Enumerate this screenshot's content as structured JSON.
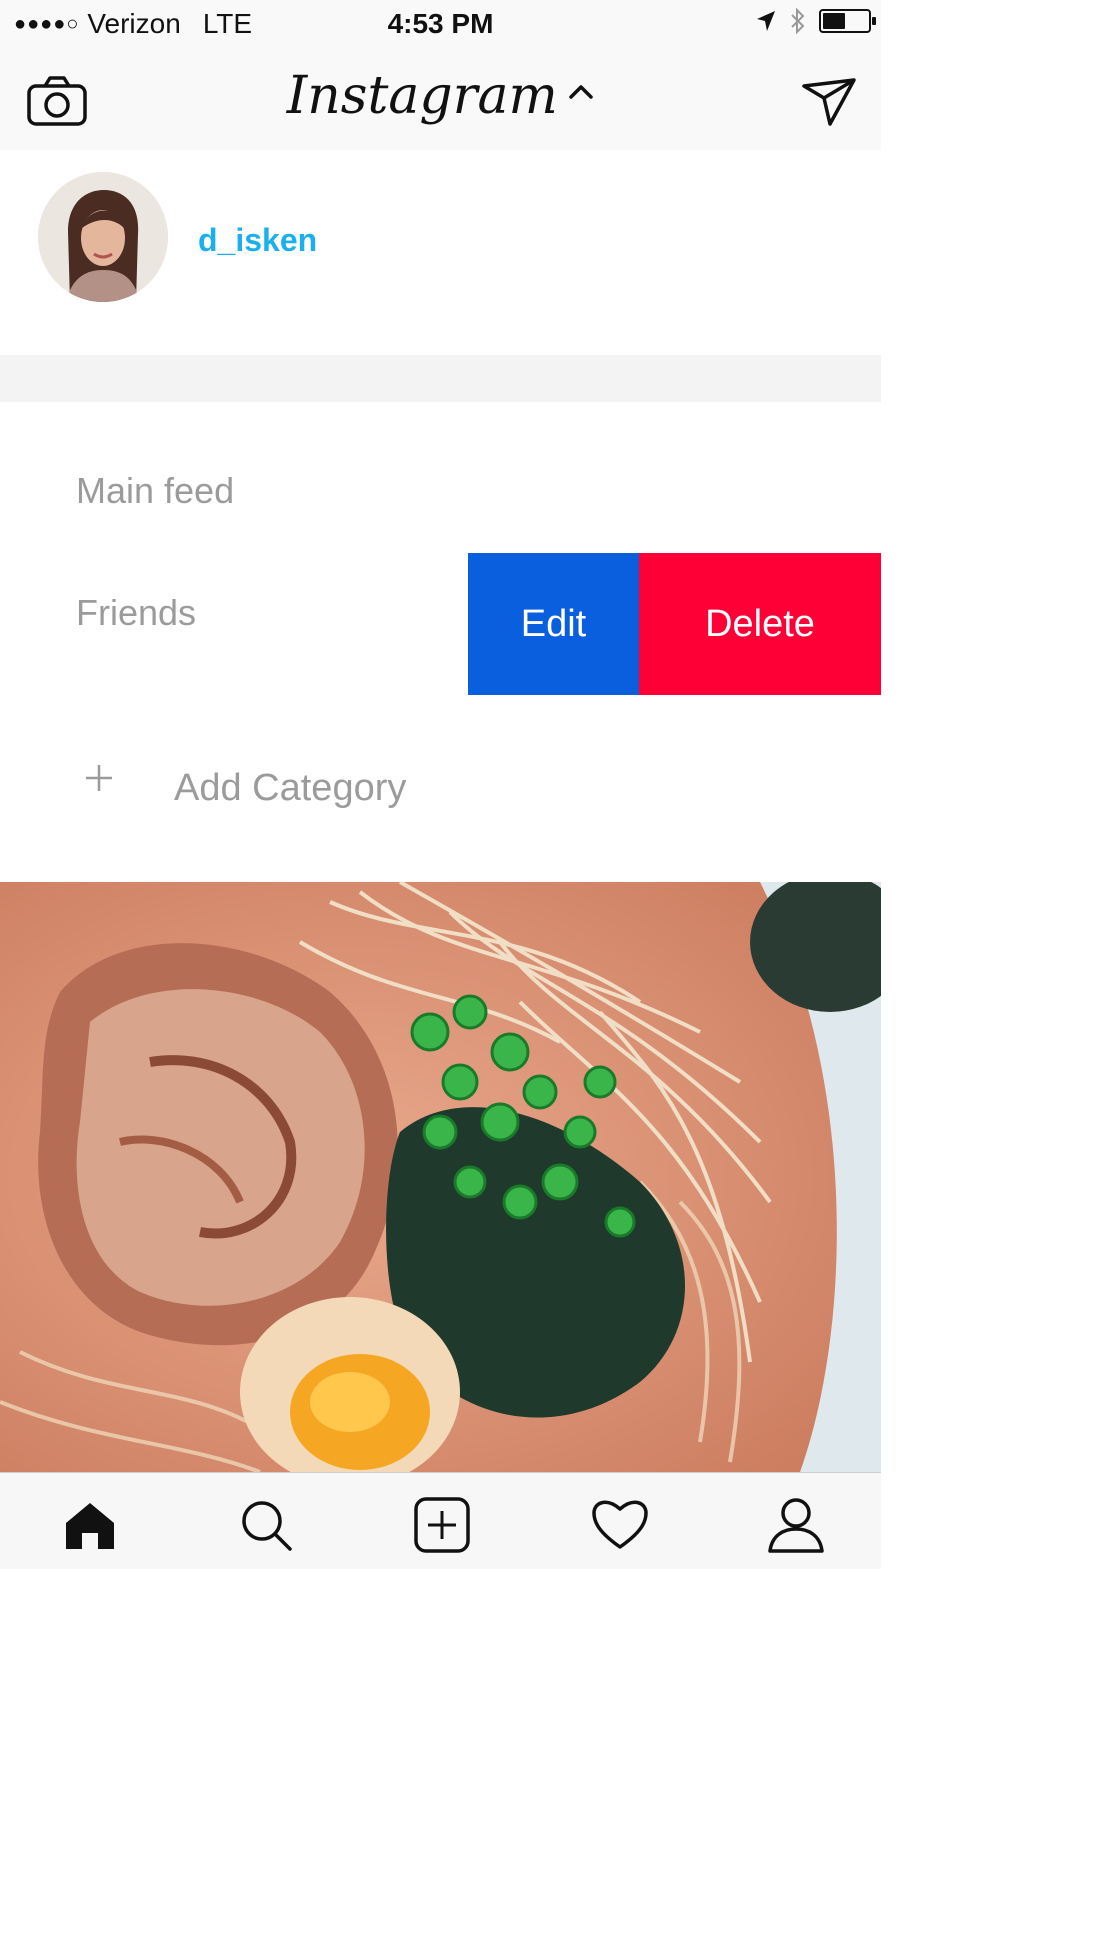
{
  "status_bar": {
    "signal": "●●●●○",
    "carrier": "Verizon",
    "network": "LTE",
    "time": "4:53 PM",
    "battery_level": 0.45
  },
  "nav": {
    "title": "Instagram"
  },
  "profile": {
    "username": "d_isken"
  },
  "categories": {
    "items": [
      "Main feed",
      "Friends"
    ],
    "add_label": "Add Category",
    "add_symbol": "+"
  },
  "swipe_actions": {
    "edit_label": "Edit",
    "delete_label": "Delete",
    "edit_color": "#0a5fdf",
    "delete_color": "#ff0036"
  },
  "tab_bar": {
    "icons": [
      "home-icon",
      "search-icon",
      "add-post-icon",
      "activity-heart-icon",
      "profile-icon"
    ],
    "active": "home-icon"
  },
  "colors": {
    "username": "#1ab0ee",
    "muted_text": "#9b9b9b"
  }
}
